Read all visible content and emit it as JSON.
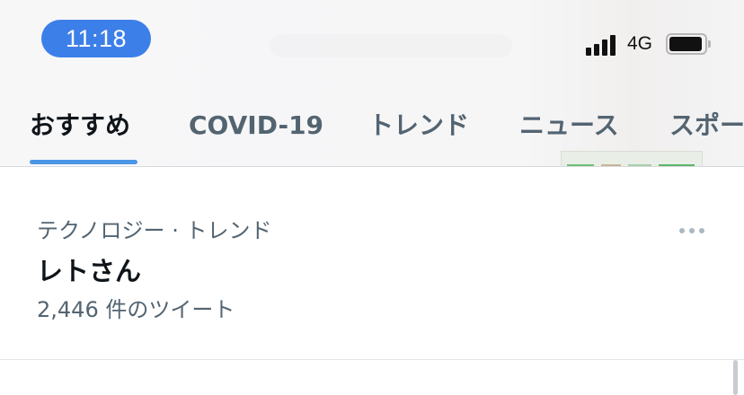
{
  "status_bar": {
    "time": "11:18",
    "network": "4G",
    "colors": {
      "time_pill": "#3d7fe8"
    }
  },
  "tabs": [
    {
      "label": "おすすめ",
      "active": true
    },
    {
      "label": "COVID-19",
      "active": false
    },
    {
      "label": "トレンド",
      "active": false
    },
    {
      "label": "ニュース",
      "active": false
    },
    {
      "label": "スポー",
      "active": false
    }
  ],
  "trend": {
    "context": "テクノロジー · トレンド",
    "name": "レトさん",
    "tweet_count": "2,446 件のツイート"
  },
  "theme": {
    "accent": "#4a95e6",
    "primary_text": "#0f1419",
    "secondary_text": "#536471"
  }
}
